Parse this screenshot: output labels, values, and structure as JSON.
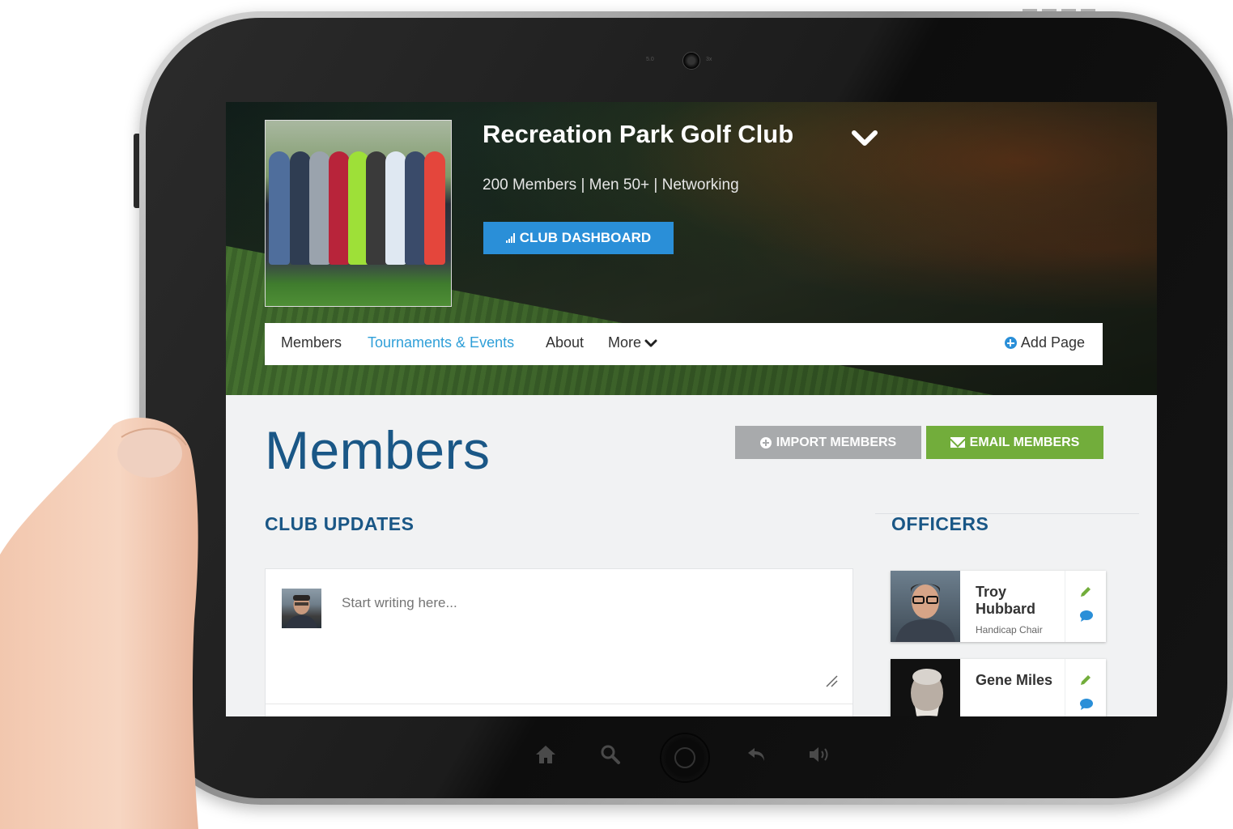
{
  "club": {
    "name": "Recreation Park Golf Club",
    "meta": "200 Members | Men 50+ | Networking",
    "dashboard_button": "CLUB DASHBOARD"
  },
  "nav": {
    "items": [
      {
        "label": "Members",
        "active": false
      },
      {
        "label": "Tournaments & Events",
        "active": true
      },
      {
        "label": "About",
        "active": false
      },
      {
        "label": "More",
        "active": false
      }
    ],
    "add_page": "Add Page"
  },
  "page": {
    "title": "Members",
    "import_button": "IMPORT MEMBERS",
    "email_button": "EMAIL MEMBERS"
  },
  "club_updates": {
    "heading": "CLUB UPDATES",
    "placeholder": "Start writing here..."
  },
  "officers": {
    "heading": "OFFICERS",
    "list": [
      {
        "name": "Troy Hubbard",
        "role": "Handicap Chair"
      },
      {
        "name": "Gene Miles",
        "role": ""
      }
    ]
  },
  "device": {
    "camera_label_left": "5.0",
    "camera_label_right": "3x"
  },
  "colors": {
    "accent_blue": "#2a8fd8",
    "heading_blue": "#1a5786",
    "active_nav": "#2f9fd8",
    "import_gray": "#a8aaac",
    "email_green": "#72ad3b",
    "screen_bg": "#f1f2f3"
  },
  "icons": {
    "title_dropdown": "chevron-down-icon",
    "dashboard": "signal-bars-icon",
    "add_page": "plus-circle-icon",
    "import": "plus-circle-icon",
    "email": "envelope-icon",
    "officer_edit": "pencil-icon",
    "officer_message": "chat-bubble-icon",
    "hardware": [
      "home-icon",
      "search-icon",
      "home-button",
      "back-icon",
      "volume-icon"
    ]
  }
}
